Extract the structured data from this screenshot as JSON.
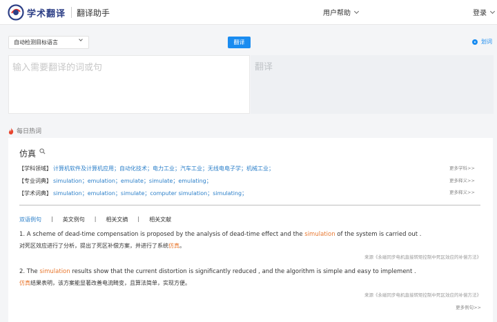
{
  "header": {
    "logo_text": "学术翻译",
    "logo_sub": "翻译助手",
    "help_label": "用户帮助",
    "login_label": "登录"
  },
  "toolbar": {
    "lang_select_value": "自动检测目标语言",
    "translate_label": "翻译",
    "huaci_label": "划词"
  },
  "source": {
    "placeholder": "输入需要翻译的词或句"
  },
  "target": {
    "placeholder": "翻译"
  },
  "hot": {
    "title": "每日热词",
    "word": "仿真",
    "definitions": [
      {
        "tag": "【学科领域】",
        "values": "计算机软件及计算机应用；自动化技术；电力工业；汽车工业；无线电电子学；机械工业；",
        "more": "更多学科>>"
      },
      {
        "tag": "【专业词典】",
        "values": "simulation；emulation；emulate；simulate；emulating；",
        "more": "更多释义>>"
      },
      {
        "tag": "【学术词典】",
        "values": "simulation；emulation；simulate；computer simulation；simulating；",
        "more": "更多释义>>"
      }
    ],
    "tabs": [
      "双语例句",
      "英文例句",
      "相关文摘",
      "相关文献"
    ],
    "examples": [
      {
        "en_pre": "1. A scheme of dead-time compensation is proposed by the analysis of dead-time effect and the ",
        "en_hl": "simulation",
        "en_post": " of the system is carried out .",
        "zh_pre": "对死区效应进行了分析，提出了死区补偿方案，并进行了系统",
        "zh_hl": "仿真",
        "zh_post": "。",
        "source": "来源《永磁同步电机直接转矩控制中死区效应的补偿方法》"
      },
      {
        "en_pre": "2. The ",
        "en_hl": "simulation",
        "en_post": " results show that the current distortion is significantly reduced , and the algorithm is simple and easy to implement .",
        "zh_pre": "",
        "zh_hl": "仿真",
        "zh_post": "结果表明，该方案能显著改善电流畸变，且算法简单，实现方便。",
        "source": "来源《永磁同步电机直接转矩控制中死区效应的补偿方法》"
      }
    ],
    "more_examples": "更多例句>>"
  },
  "colors": {
    "accent": "#1a8cf0",
    "link": "#2b7fc9",
    "highlight": "#e8772e",
    "brand": "#2d3f86"
  }
}
